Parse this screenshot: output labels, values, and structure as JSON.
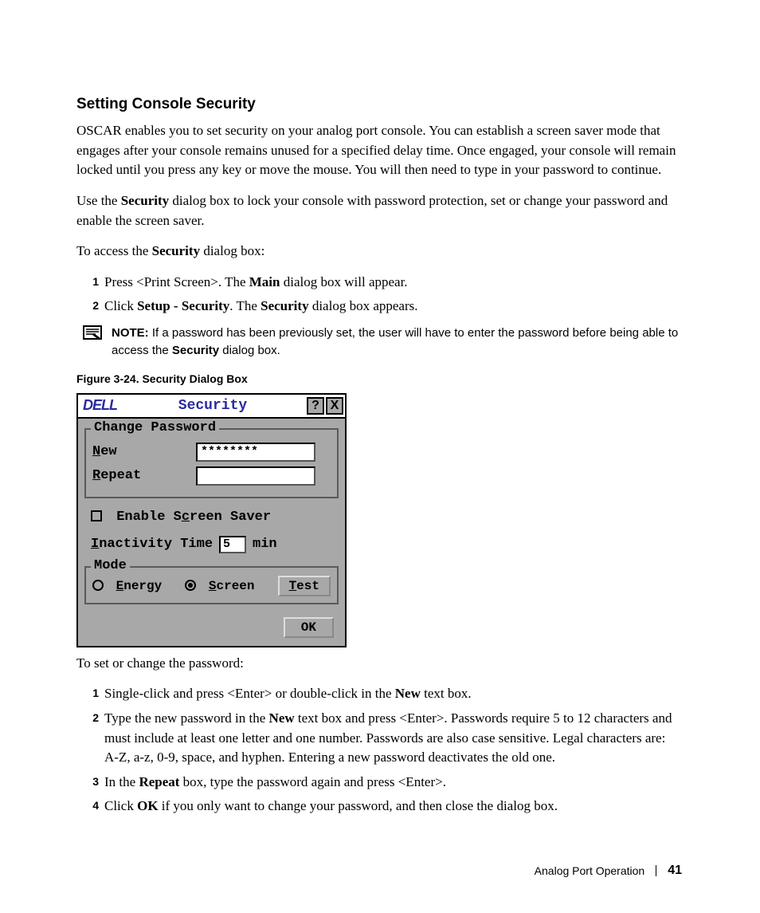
{
  "heading": "Setting Console Security",
  "para1": "OSCAR enables you to set security on your analog port console. You can establish a screen saver mode that engages after your console remains unused for a specified delay time. Once engaged, your console will remain locked until you press any key or move the mouse. You will then need to type in your password to continue.",
  "para2_pre": "Use the ",
  "para2_bold": "Security",
  "para2_post": " dialog box to lock your console with password protection, set or change your password and enable the screen saver.",
  "para3_pre": "To access the ",
  "para3_bold": "Security",
  "para3_post": " dialog box:",
  "steps_a": [
    {
      "n": "1",
      "pre": "Press <Print Screen>. The ",
      "b": "Main",
      "post": " dialog box will appear."
    },
    {
      "n": "2",
      "pre": "Click ",
      "b": "Setup - Security",
      "post2_pre": ". The ",
      "b2": "Security",
      "post": " dialog box appears."
    }
  ],
  "note_label": "NOTE:",
  "note_text_pre": " If a password has been previously set, the user will have to enter the password before being able to access the ",
  "note_bold": "Security",
  "note_text_post": " dialog box.",
  "figure_caption": "Figure 3-24.    Security Dialog Box",
  "dialog": {
    "logo": "DELL",
    "title": "Security",
    "help": "?",
    "close": "X",
    "group_change": "Change Password",
    "label_new_u": "N",
    "label_new_rest": "ew",
    "new_value": "********",
    "label_repeat_u": "R",
    "label_repeat_rest": "epeat",
    "repeat_value": "",
    "enable_ss_pre": "Enable S",
    "enable_ss_u": "c",
    "enable_ss_post": "reen Saver",
    "inactivity_u": "I",
    "inactivity_rest": "nactivity Time",
    "inactivity_value": "5",
    "min": "min",
    "group_mode": "Mode",
    "energy_u": "E",
    "energy_rest": "nergy",
    "screen_u": "S",
    "screen_rest": "creen",
    "test_u": "T",
    "test_rest": "est",
    "ok": "OK"
  },
  "para4": "To set or change the password:",
  "steps_b": [
    {
      "n": "1",
      "pre": "Single-click and press <Enter> or double-click in the ",
      "b": "New",
      "post": " text box."
    },
    {
      "n": "2",
      "pre": "Type the new password in the ",
      "b": "New",
      "post": " text box and press <Enter>. Passwords require 5 to 12 characters and must include at least one letter and one number. Passwords are also case sensitive. Legal characters are: A-Z, a-z, 0-9, space, and hyphen. Entering a new password deactivates the old one."
    },
    {
      "n": "3",
      "pre": "In the ",
      "b": "Repeat",
      "post": " box, type the password again and press <Enter>."
    },
    {
      "n": "4",
      "pre": "Click ",
      "b": "OK",
      "post": " if you only want to change your password, and then close the dialog box."
    }
  ],
  "footer_section": "Analog Port Operation",
  "footer_page": "41"
}
